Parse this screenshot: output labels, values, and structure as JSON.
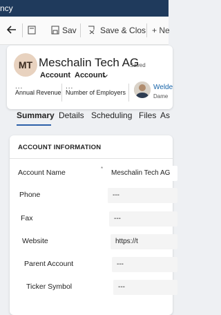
{
  "window": {
    "title": "ncy"
  },
  "toolbar": {
    "back_label": "",
    "save_label": "Sav",
    "save_close_label": "Save & Clos",
    "new_label": "+ Ne"
  },
  "header": {
    "initials": "MT",
    "name": "Meschalin Tech AG",
    "status": "Saved",
    "entity": "Account",
    "separator": "·",
    "form": "Account",
    "annual_revenue_value": "...",
    "annual_revenue_label": "Annual Revenue",
    "employees_value": "...",
    "employees_label": "Number of Employers",
    "owner_name": "Welde",
    "owner_role": "Dame"
  },
  "tabs": [
    "Summary",
    "Details",
    "Scheduling",
    "Files",
    "As"
  ],
  "section": {
    "title": "ACCOUNT INFORMATION",
    "fields": [
      {
        "label": "Account Name",
        "value": "Meschalin Tech AG",
        "marker": "*"
      },
      {
        "label": "Phone",
        "value": "---"
      },
      {
        "label": "Fax",
        "value": "---"
      },
      {
        "label": "Website",
        "value": "https://t"
      },
      {
        "label": "Parent Account",
        "value": "---"
      },
      {
        "label": "Ticker Symbol",
        "value": "---"
      }
    ]
  },
  "colors": {
    "title_bar": "#1f3a5c",
    "accent": "#2b5fa8",
    "link": "#1663a8"
  }
}
